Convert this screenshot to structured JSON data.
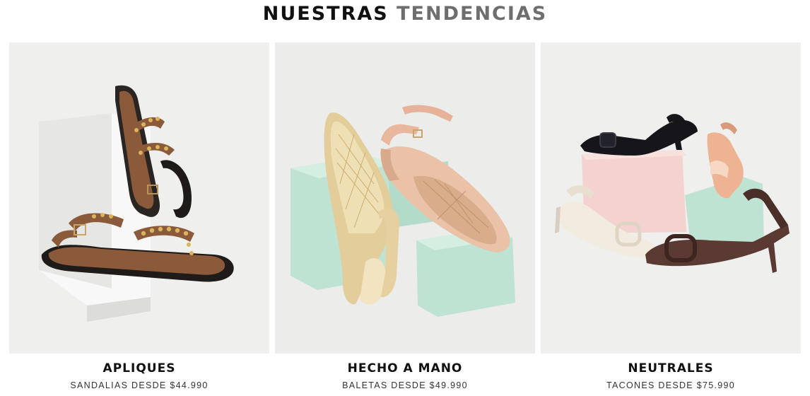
{
  "heading": {
    "part1": "NUESTRAS",
    "part2": "TENDENCIAS"
  },
  "cards": [
    {
      "title": "APLIQUES",
      "subtitle": "SANDALIAS DESDE $44.990",
      "image": "brown-studded-strap-sandals"
    },
    {
      "title": "HECHO A MANO",
      "subtitle": "BALETAS DESDE $49.990",
      "image": "woven-pointed-flats-gold-and-nude"
    },
    {
      "title": "NEUTRALES",
      "subtitle": "TACONES DESDE $75.990",
      "image": "buckle-kitten-heels-black-cream-brown-peach"
    }
  ],
  "colors": {
    "heading_primary": "#111111",
    "heading_secondary": "#6e6e6e",
    "photo_background": "#eeeeec",
    "block_mint": "#bfe3d3",
    "block_pink": "#f3d2cf"
  }
}
